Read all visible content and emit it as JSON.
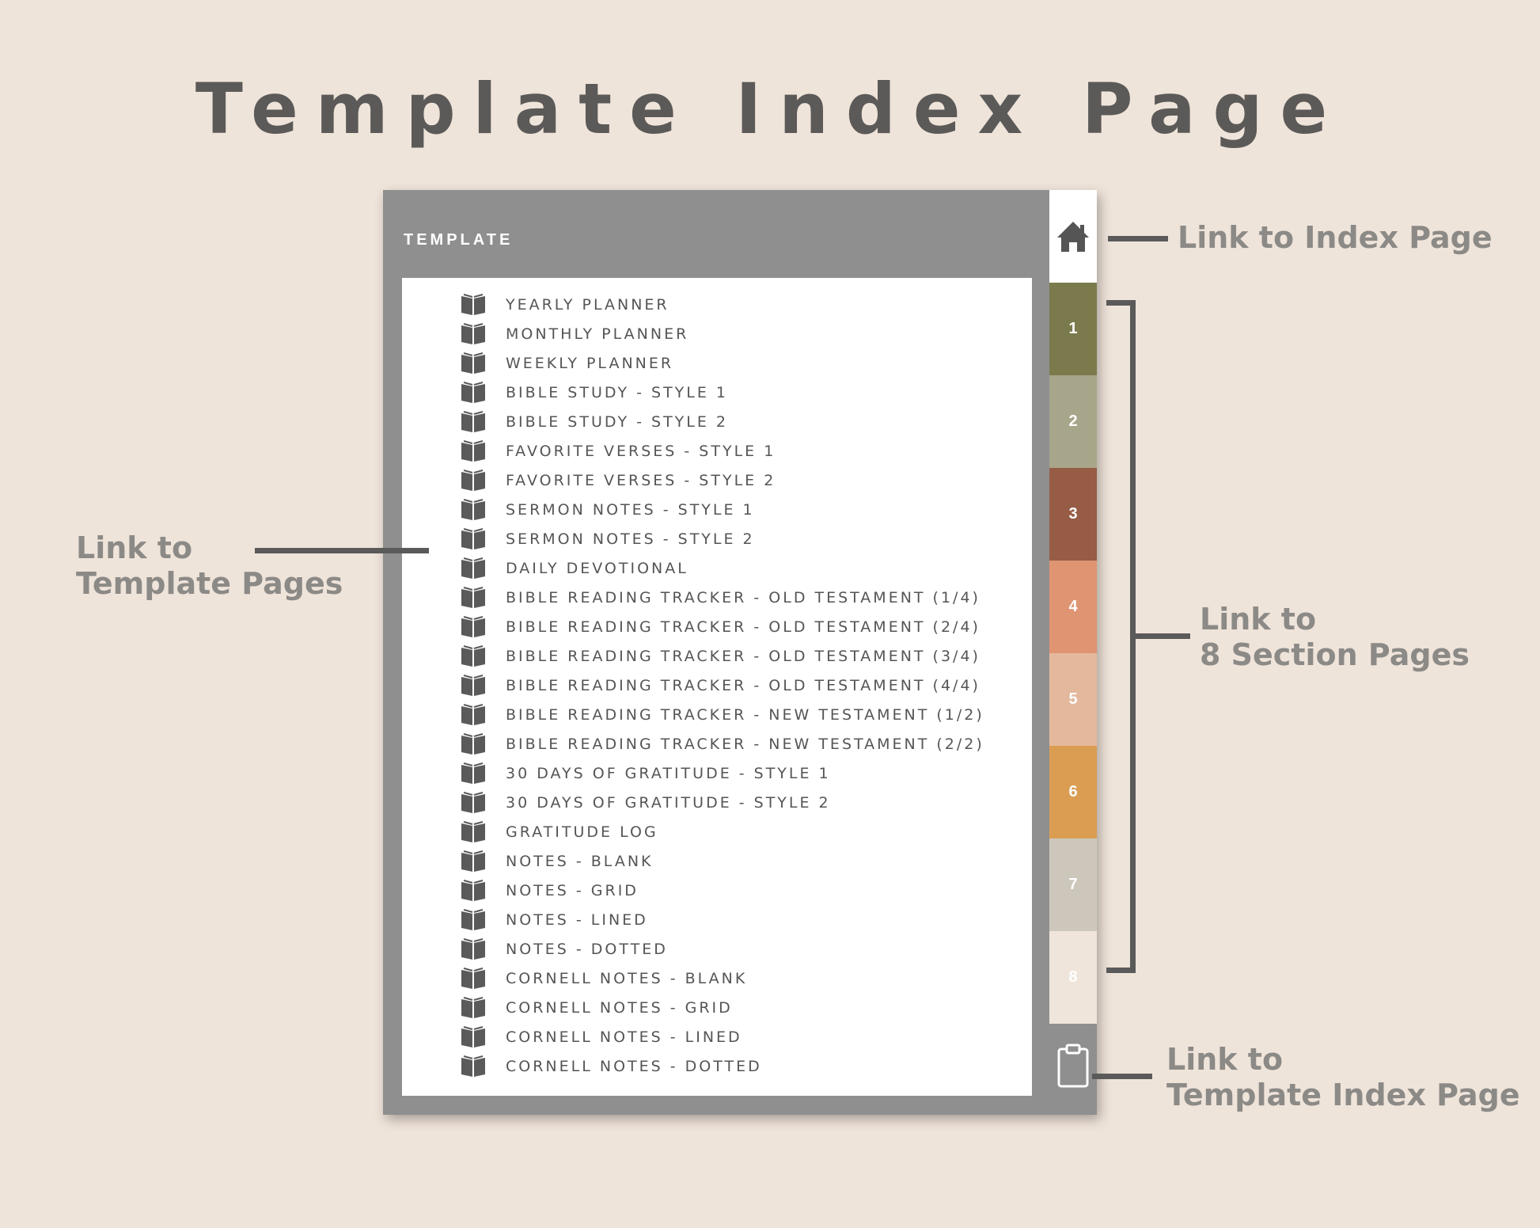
{
  "title": "Template Index Page",
  "planner": {
    "header": "TEMPLATE",
    "items": [
      {
        "label": "YEARLY PLANNER"
      },
      {
        "label": "MONTHLY PLANNER"
      },
      {
        "label": "WEEKLY PLANNER"
      },
      {
        "label": "BIBLE STUDY - STYLE 1"
      },
      {
        "label": "BIBLE STUDY - STYLE 2"
      },
      {
        "label": "FAVORITE VERSES - STYLE 1"
      },
      {
        "label": "FAVORITE VERSES - STYLE 2"
      },
      {
        "label": "SERMON NOTES - STYLE 1"
      },
      {
        "label": "SERMON NOTES - STYLE 2"
      },
      {
        "label": "DAILY DEVOTIONAL"
      },
      {
        "label": "BIBLE READING TRACKER - OLD TESTAMENT (1/4)"
      },
      {
        "label": "BIBLE READING TRACKER - OLD TESTAMENT (2/4)"
      },
      {
        "label": "BIBLE READING TRACKER - OLD TESTAMENT (3/4)"
      },
      {
        "label": "BIBLE READING TRACKER - OLD TESTAMENT (4/4)"
      },
      {
        "label": "BIBLE READING TRACKER - NEW TESTAMENT (1/2)"
      },
      {
        "label": "BIBLE READING TRACKER - NEW TESTAMENT (2/2)"
      },
      {
        "label": "30 DAYS OF GRATITUDE - STYLE 1"
      },
      {
        "label": "30 DAYS OF GRATITUDE - STYLE 2"
      },
      {
        "label": "GRATITUDE LOG"
      },
      {
        "label": "NOTES - BLANK"
      },
      {
        "label": "NOTES - GRID"
      },
      {
        "label": "NOTES - LINED"
      },
      {
        "label": "NOTES - DOTTED"
      },
      {
        "label": "CORNELL NOTES - BLANK"
      },
      {
        "label": "CORNELL NOTES - GRID"
      },
      {
        "label": "CORNELL NOTES - LINED"
      },
      {
        "label": "CORNELL NOTES - DOTTED"
      }
    ],
    "item_icon": "book-icon",
    "home_icon": "home-icon",
    "clipboard_icon": "clipboard-icon",
    "tabs": [
      {
        "label": "1",
        "color": "#7a7a4c",
        "text_color": "#ffffff"
      },
      {
        "label": "2",
        "color": "#a8a68a",
        "text_color": "#ffffff"
      },
      {
        "label": "3",
        "color": "#975c45",
        "text_color": "#ffffff"
      },
      {
        "label": "4",
        "color": "#df9472",
        "text_color": "#ffffff"
      },
      {
        "label": "5",
        "color": "#e4b89d",
        "text_color": "#ffffff"
      },
      {
        "label": "6",
        "color": "#db9d52",
        "text_color": "#ffffff"
      },
      {
        "label": "7",
        "color": "#cdc7bb",
        "text_color": "#ffffff"
      },
      {
        "label": "8",
        "color": "#efe5db",
        "text_color": "#ffffff"
      }
    ]
  },
  "annotations": {
    "index_link": "Link to Index Page",
    "template_pages_line1": "Link to",
    "template_pages_line2": "Template Pages",
    "sections_line1": "Link to",
    "sections_line2": "8 Section Pages",
    "template_index_line1": "Link to",
    "template_index_line2": "Template Index Page"
  },
  "colors": {
    "background": "#efe4da",
    "planner_frame": "#8f8f8f",
    "annotation_text": "#8c8a87",
    "title_text": "#5c5a58"
  }
}
